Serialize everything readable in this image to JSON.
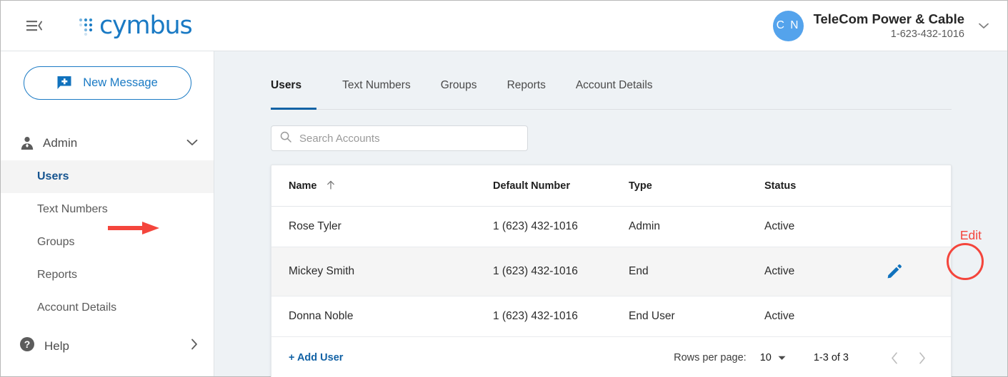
{
  "header": {
    "menu_icon": "hamburger-collapse-icon",
    "logo_text": "cymbus",
    "account": {
      "initials": "C N",
      "name": "TeleCom Power & Cable",
      "phone": "1-623-432-1016",
      "caret_icon": "chevron-down-icon"
    }
  },
  "sidebar": {
    "new_message": {
      "label": "New Message",
      "icon": "message-plus-icon"
    },
    "group": {
      "label": "Admin",
      "icon": "admin-person-icon",
      "caret_icon": "chevron-down-icon"
    },
    "items": [
      {
        "label": "Users",
        "active": true
      },
      {
        "label": "Text Numbers",
        "active": false
      },
      {
        "label": "Groups",
        "active": false
      },
      {
        "label": "Reports",
        "active": false
      },
      {
        "label": "Account Details",
        "active": false
      }
    ],
    "help": {
      "label": "Help",
      "icon": "help-circle-icon",
      "caret_icon": "chevron-right-icon"
    }
  },
  "main": {
    "tabs": [
      {
        "label": "Users",
        "active": true
      },
      {
        "label": "Text Numbers",
        "active": false
      },
      {
        "label": "Groups",
        "active": false
      },
      {
        "label": "Reports",
        "active": false
      },
      {
        "label": "Account Details",
        "active": false
      }
    ],
    "search": {
      "placeholder": "Search Accounts",
      "value": "",
      "icon": "search-icon"
    },
    "table": {
      "columns": [
        "Name",
        "Default Number",
        "Type",
        "Status"
      ],
      "sort_column": "Name",
      "sort_direction": "asc",
      "rows": [
        {
          "name": "Rose Tyler",
          "number": "1 (623) 432-1016",
          "type": "Admin",
          "status": "Active",
          "hovered": false
        },
        {
          "name": "Mickey Smith",
          "number": "1 (623) 432-1016",
          "type": "End",
          "status": "Active",
          "hovered": true
        },
        {
          "name": "Donna Noble",
          "number": "1 (623) 432-1016",
          "type": "End User",
          "status": "Active",
          "hovered": false
        }
      ]
    },
    "footer": {
      "add_user": "+ Add User",
      "rows_per_page_label": "Rows per page:",
      "rows_per_page_value": "10",
      "range": "1-3 of 3",
      "prev_icon": "chevron-left-icon",
      "next_icon": "chevron-right-icon"
    }
  },
  "annotations": {
    "edit_label": "Edit",
    "arrow_color": "#f4453c",
    "highlight_color": "#f4453c"
  },
  "colors": {
    "brand_blue": "#1a7ac4",
    "accent_blue": "#1262a5",
    "avatar_blue": "#54a3ec",
    "annotation_red": "#f4453c",
    "page_bg": "#eef2f5"
  }
}
